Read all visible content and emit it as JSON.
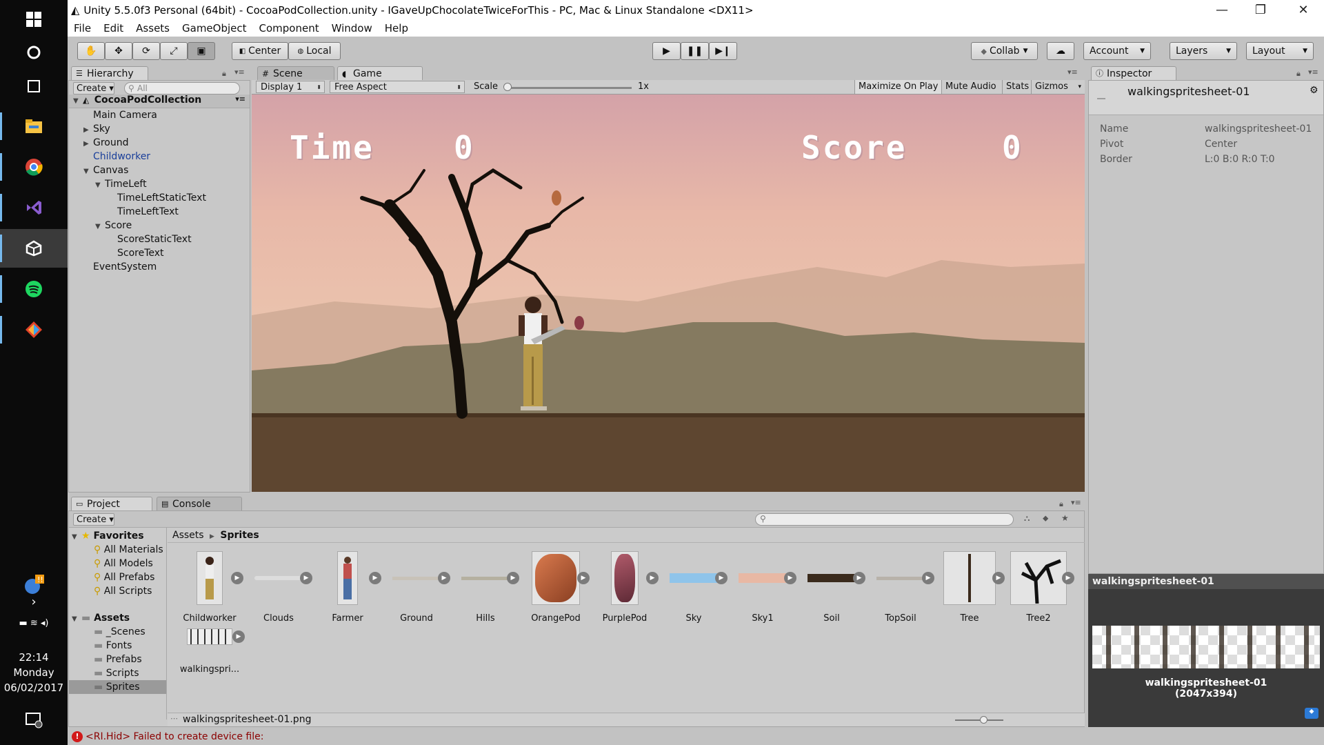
{
  "window": {
    "title": "Unity 5.5.0f3 Personal (64bit) - CocoaPodCollection.unity - IGaveUpChocolateTwiceForThis - PC, Mac & Linux Standalone <DX11>"
  },
  "menu": [
    "File",
    "Edit",
    "Assets",
    "GameObject",
    "Component",
    "Window",
    "Help"
  ],
  "toolbar": {
    "center": "Center",
    "local": "Local",
    "collab": "Collab",
    "account": "Account",
    "layers": "Layers",
    "layout": "Layout"
  },
  "hierarchy": {
    "tab": "Hierarchy",
    "create": "Create",
    "search_placeholder": "All",
    "scene": "CocoaPodCollection",
    "items": [
      "Main Camera",
      "Sky",
      "Ground",
      "Childworker",
      "Canvas",
      "TimeLeft",
      "TimeLeftStaticText",
      "TimeLeftText",
      "Score",
      "ScoreStaticText",
      "ScoreText",
      "EventSystem"
    ]
  },
  "view_tabs": {
    "scene": "Scene",
    "game": "Game"
  },
  "game_bar": {
    "display": "Display 1",
    "aspect": "Free Aspect",
    "scale": "Scale",
    "scale_val": "1x",
    "maximize": "Maximize On Play",
    "mute": "Mute Audio",
    "stats": "Stats",
    "gizmos": "Gizmos"
  },
  "hud": {
    "time_label": "Time",
    "time_value": "0",
    "score_label": "Score",
    "score_value": "0"
  },
  "inspector": {
    "tab": "Inspector",
    "asset": "walkingspritesheet-01",
    "rows": [
      {
        "k": "Name",
        "v": "walkingspritesheet-01"
      },
      {
        "k": "Pivot",
        "v": "Center"
      },
      {
        "k": "Border",
        "v": "L:0 B:0 R:0 T:0"
      }
    ],
    "preview_title": "walkingspritesheet-01",
    "preview_name": "walkingspritesheet-01",
    "preview_size": "(2047x394)"
  },
  "project": {
    "tab": "Project",
    "console": "Console",
    "create": "Create",
    "crumb_root": "Assets",
    "crumb_leaf": "Sprites",
    "favorites": "Favorites",
    "fav_items": [
      "All Materials",
      "All Models",
      "All Prefabs",
      "All Scripts"
    ],
    "assets": "Assets",
    "folders": [
      "_Scenes",
      "Fonts",
      "Prefabs",
      "Scripts",
      "Sprites"
    ],
    "items": [
      "Childworker",
      "Clouds",
      "Farmer",
      "Ground",
      "Hills",
      "OrangePod",
      "PurplePod",
      "Sky",
      "Sky1",
      "Soil",
      "TopSoil",
      "Tree",
      "Tree2"
    ],
    "walking": "walkingspri...",
    "footer": "walkingspritesheet-01.png"
  },
  "status": "<RI.Hid> Failed to create device file:",
  "clock": {
    "time": "22:14",
    "day": "Monday",
    "date": "06/02/2017"
  }
}
